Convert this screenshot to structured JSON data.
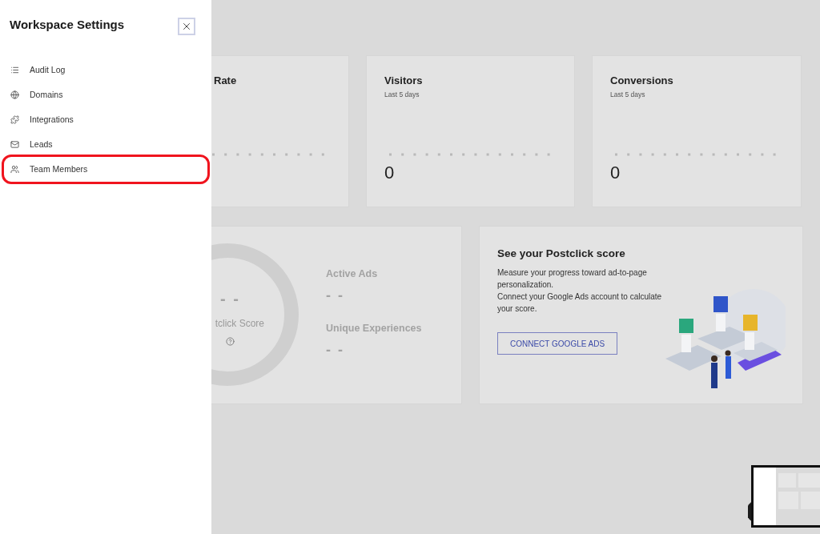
{
  "drawer": {
    "title": "Workspace Settings",
    "items": [
      {
        "label": "Audit Log",
        "highlighted": false
      },
      {
        "label": "Domains",
        "highlighted": false
      },
      {
        "label": "Integrations",
        "highlighted": false
      },
      {
        "label": "Leads",
        "highlighted": false
      },
      {
        "label": "Team Members",
        "highlighted": true
      }
    ]
  },
  "stat_cards": [
    {
      "title": "Rate"
    },
    {
      "title": "Visitors",
      "subtitle": "Last 5 days",
      "value": "0"
    },
    {
      "title": "Conversions",
      "subtitle": "Last 5 days",
      "value": "0"
    }
  ],
  "score_card": {
    "score": "- -",
    "score_label": "tclick Score",
    "metrics": [
      {
        "label": "Active Ads",
        "value": "- -"
      },
      {
        "label": "Unique Experiences",
        "value": "- -"
      }
    ]
  },
  "promo_card": {
    "title": "See your Postclick score",
    "lines": [
      "Measure your progress toward ad-to-page personalization.",
      "Connect your Google Ads account to calculate your score."
    ],
    "button": "CONNECT GOOGLE ADS",
    "illustration": {
      "kind": "picture"
    }
  },
  "preview": {
    "kind": "picture"
  }
}
